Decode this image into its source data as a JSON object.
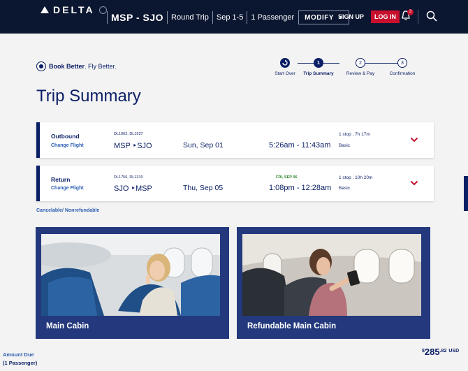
{
  "header": {
    "logo_text": "DELTA",
    "route": "MSP - SJO",
    "trip_type": "Round Trip",
    "dates": "Sep 1-5",
    "passengers": "1 Passenger",
    "modify_label": "MODIFY",
    "signup_label": "SIGN UP",
    "login_label": "LOG IN",
    "notification_count": "3"
  },
  "book_better": {
    "bold": "Book Better",
    "rest": ". Fly Better."
  },
  "stepper": {
    "steps": [
      {
        "label": "Start Over",
        "marker": ""
      },
      {
        "label": "Trip Summary",
        "marker": "1"
      },
      {
        "label": "Review & Pay",
        "marker": "2"
      },
      {
        "label": "Confirmation",
        "marker": "3"
      }
    ]
  },
  "page_title": "Trip Summary",
  "flights": [
    {
      "direction": "Outbound",
      "change_label": "Change Flight",
      "flight_numbers": "DL1062, DL1937",
      "from": "MSP",
      "to": "SJO",
      "date": "Sun, Sep 01",
      "next_day": "",
      "times": "5:26am - 11:43am",
      "stops": "1 stop , 7h 17m",
      "fare_class": "Basic"
    },
    {
      "direction": "Return",
      "change_label": "Change Flight",
      "flight_numbers": "DL1756, DL1310",
      "from": "SJO",
      "to": "MSP",
      "date": "Thu, Sep 05",
      "next_day": "FRI, SEP 06",
      "times": "1:08pm - 12:28am",
      "stops": "1 stop , 10h 20m",
      "fare_class": "Basic"
    }
  ],
  "cancel_note": "Cancelable/ Nonrefundable",
  "cabins": [
    {
      "name": "Main Cabin"
    },
    {
      "name": "Refundable Main Cabin"
    }
  ],
  "footer": {
    "amount_label": "Amount Due",
    "passengers": "(1 Passenger)",
    "currency_symbol": "$",
    "price_whole": "285",
    "price_cents": ".82",
    "currency": "USD"
  },
  "colors": {
    "header_bg": "#0b1630",
    "brand_navy": "#0b1f66",
    "login_red": "#c8102e",
    "link_blue": "#2b5fb3",
    "cabin_card_bg": "#24397d"
  }
}
